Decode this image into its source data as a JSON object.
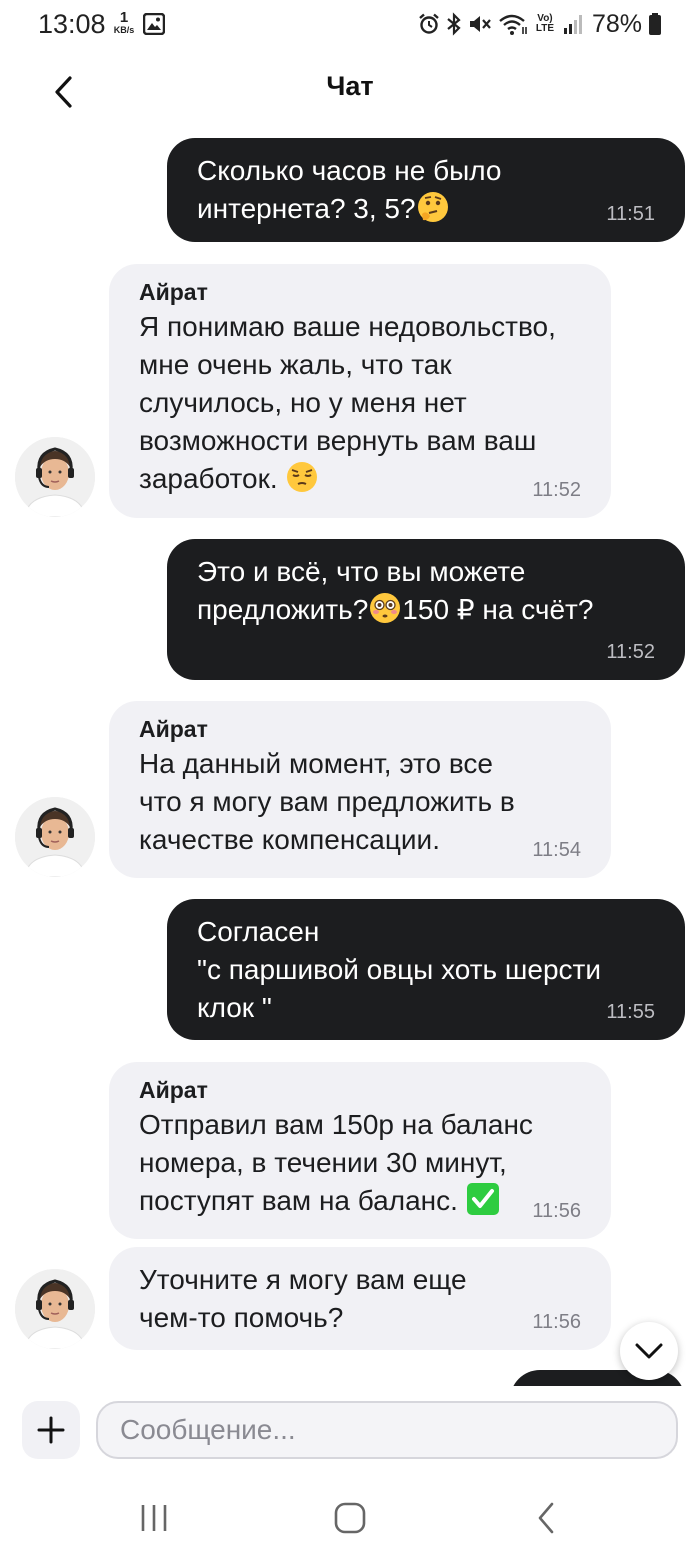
{
  "status_bar": {
    "time": "13:08",
    "speed_value": "1",
    "speed_unit": "KB/s",
    "volte_label": "Vo) LTE",
    "battery": "78%"
  },
  "header": {
    "title": "Чат"
  },
  "messages": [
    {
      "direction": "outgoing",
      "text": "Сколько часов не было\nинтернета? 3, 5?",
      "emoji": "thinking-face",
      "time": "11:51"
    },
    {
      "direction": "incoming",
      "sender": "Айрат",
      "text": "Я понимаю ваше недовольство,\nмне очень жаль, что так\nслучилось, но у меня нет\nвозможности вернуть вам ваш\nзаработок. ",
      "emoji": "pensive-face",
      "time": "11:52"
    },
    {
      "direction": "outgoing",
      "text_a": "Это и всё, что вы можете\nпредложить?",
      "text_b": "150 ₽ на счёт?",
      "emoji": "flushed-face",
      "time": "11:52"
    },
    {
      "direction": "incoming",
      "sender": "Айрат",
      "text": "На данный момент, это все\nчто я могу вам предложить в\nкачестве компенсации.",
      "time": "11:54"
    },
    {
      "direction": "outgoing",
      "text": "Согласен\n\"с паршивой овцы хоть шерсти\nклок \"",
      "time": "11:55"
    },
    {
      "direction": "incoming",
      "sender": "Айрат",
      "text": "Отправил вам 150р на баланс\nномера, в течении 30 минут,\nпоступят вам на баланс. ",
      "emoji": "check-mark-button",
      "time": "11:56"
    },
    {
      "direction": "incoming",
      "text": "Уточните я могу вам еще\nчем-то помочь?",
      "time": "11:56"
    }
  ],
  "composer": {
    "placeholder": "Сообщение..."
  },
  "colors": {
    "outgoing_bubble": "#1c1d1f",
    "incoming_bubble": "#f1f1f5",
    "check_green": "#2ecc40",
    "emoji_yellow": "#ffc83d"
  }
}
